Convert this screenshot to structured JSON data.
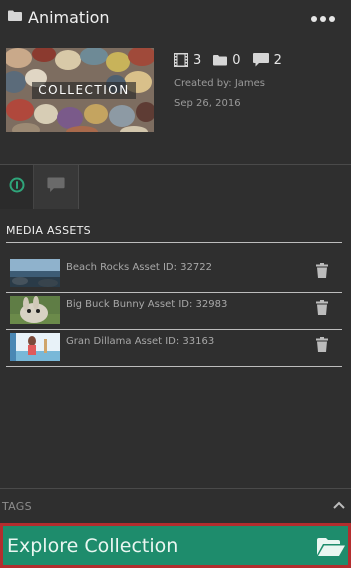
{
  "header": {
    "title": "Animation",
    "folder_icon": "folder-icon",
    "more_icon": "more-options-icon"
  },
  "collection": {
    "thumbnail_label": "COLLECTION",
    "stats": [
      {
        "icon": "film-icon",
        "value": "3"
      },
      {
        "icon": "folder-icon",
        "value": "0"
      },
      {
        "icon": "comment-icon",
        "value": "2"
      }
    ],
    "created_by": "Created by: James",
    "date": "Sep 26, 2016"
  },
  "tabs": [
    {
      "icon": "info-icon",
      "active": true
    },
    {
      "icon": "comment-icon",
      "active": false
    }
  ],
  "media_assets": {
    "heading": "MEDIA ASSETS",
    "items": [
      {
        "label": "Beach Rocks Asset ID: 32722",
        "thumb_icon": "beach-thumbnail"
      },
      {
        "label": "Big Buck Bunny Asset ID: 32983",
        "thumb_icon": "bunny-thumbnail"
      },
      {
        "label": "Gran Dillama Asset ID: 33163",
        "thumb_icon": "dillama-thumbnail"
      }
    ]
  },
  "tags": {
    "label": "TAGS"
  },
  "footer": {
    "explore_label": "Explore Collection",
    "explore_icon": "open-folder-icon"
  },
  "colors": {
    "background": "#2f2f2f",
    "accent_green": "#1e8c6c",
    "highlight_red": "#b32d2e",
    "active_tab_icon": "#2fa57a"
  }
}
